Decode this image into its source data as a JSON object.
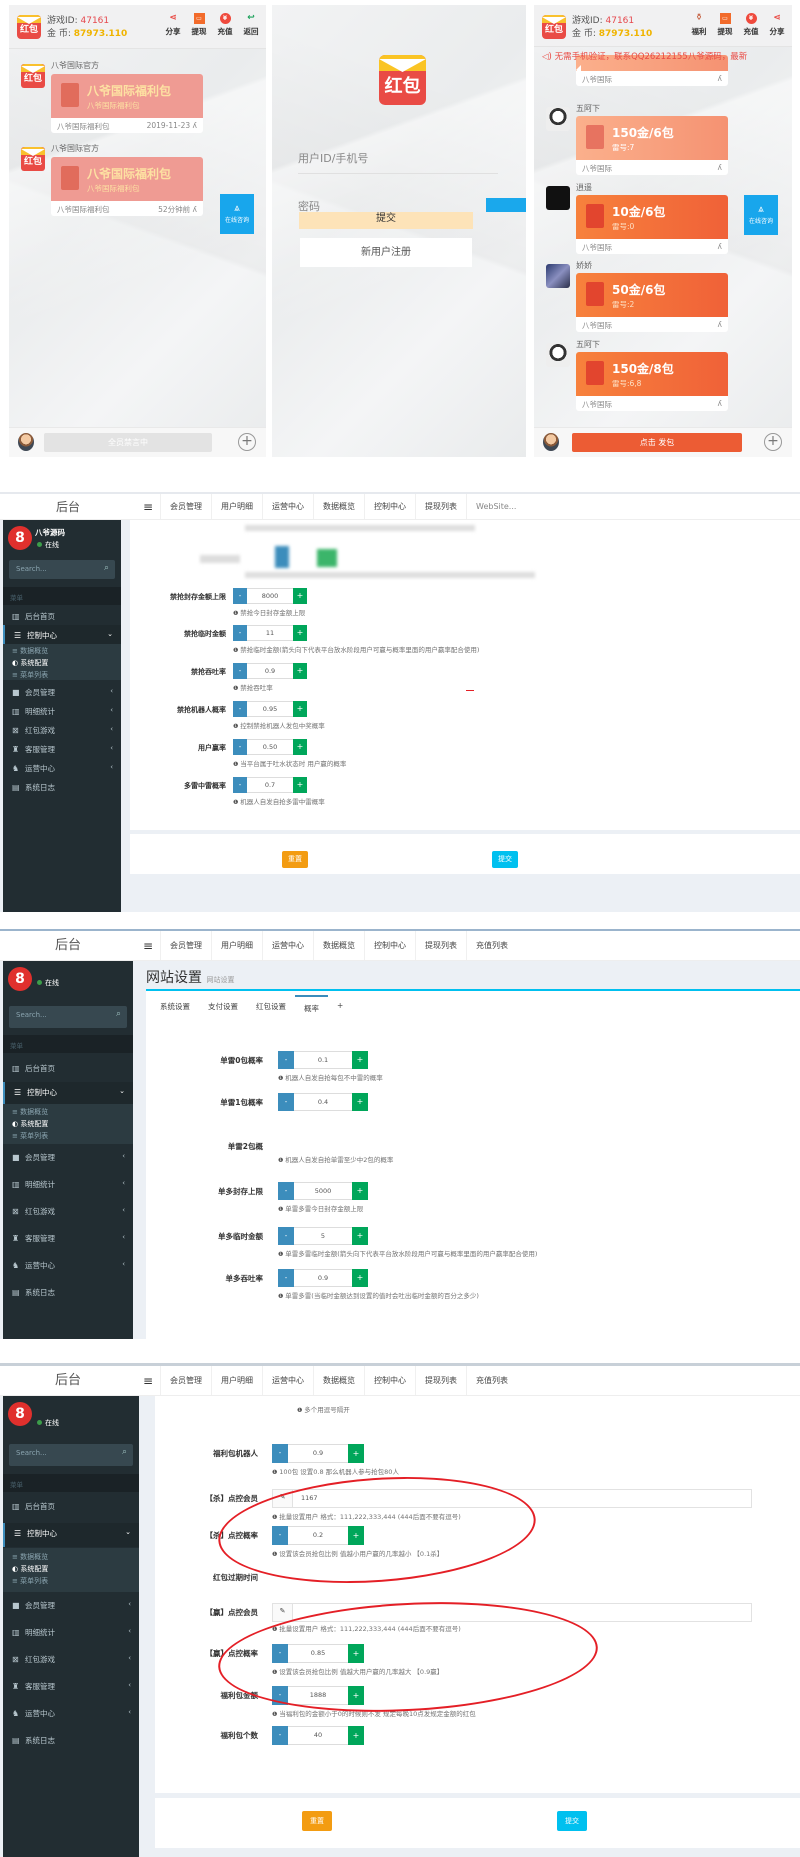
{
  "phone_left": {
    "game_id_label": "游戏ID:",
    "game_id": "47161",
    "coins_label": "金  币:",
    "coins": "87973.110",
    "logo_text": "红包",
    "top_icons": [
      {
        "icon": "share-icon",
        "label": "分享"
      },
      {
        "icon": "withdraw-icon",
        "label": "提现"
      },
      {
        "icon": "recharge-icon",
        "label": "充值"
      },
      {
        "icon": "back-icon",
        "label": "返回"
      }
    ],
    "messages": [
      {
        "sender": "八爷国际官方",
        "title": "八爷国际福利包",
        "subtitle": "八爷国际福利包",
        "footer": "八爷国际福利包",
        "time": "2019-11-23"
      },
      {
        "sender": "八爷国际官方",
        "title": "八爷国际福利包",
        "subtitle": "八爷国际福利包",
        "footer": "八爷国际福利包",
        "time": "52分钟前"
      }
    ],
    "online_consult": "在线咨询",
    "footer_button": "全员禁言中"
  },
  "phone_login": {
    "logo_text": "红包",
    "username_placeholder": "用户ID/手机号",
    "password_placeholder": "密码",
    "submit": "提交",
    "register": "新用户注册"
  },
  "phone_right": {
    "game_id_label": "游戏ID:",
    "game_id": "47161",
    "coins_label": "金  币:",
    "coins": "87973.110",
    "logo_text": "红包",
    "top_icons": [
      {
        "icon": "welfare-bag-icon",
        "label": "福利"
      },
      {
        "icon": "withdraw-icon",
        "label": "提现"
      },
      {
        "icon": "recharge-icon",
        "label": "充值"
      },
      {
        "icon": "share-icon",
        "label": "分享"
      }
    ],
    "marquee": "无需手机验证，联系QQ26212155八爷源码，最新",
    "partial_footer": "八爷国际",
    "messages": [
      {
        "sender": "五阿下",
        "title": "150金/6包",
        "subtitle": "雷号:7",
        "footer": "八爷国际"
      },
      {
        "sender": "逍遥",
        "title": "10金/6包",
        "subtitle": "雷号:0",
        "footer": "八爷国际"
      },
      {
        "sender": "娇娇",
        "title": "50金/6包",
        "subtitle": "雷号:2",
        "footer": "八爷国际"
      },
      {
        "sender": "五阿下",
        "title": "150金/8包",
        "subtitle": "雷号:6,8",
        "footer": "八爷国际"
      }
    ],
    "online_consult": "在线咨询",
    "footer_button": "点击 发包"
  },
  "admin_common": {
    "brand": "后台",
    "nav": [
      "会员管理",
      "用户明细",
      "运营中心",
      "数据概览",
      "控制中心",
      "提现列表",
      "充值列表"
    ],
    "search_placeholder": "Search...",
    "status": "在线",
    "menu_header": "菜单",
    "sidebar": [
      {
        "icon": "chart-icon",
        "label": "后台首页"
      },
      {
        "icon": "control-icon",
        "label": "控制中心",
        "expanded": true
      },
      {
        "icon": "member-icon",
        "label": "会员管理"
      },
      {
        "icon": "stats-icon",
        "label": "明细统计"
      },
      {
        "icon": "game-icon",
        "label": "红包游戏"
      },
      {
        "icon": "service-icon",
        "label": "客服管理"
      },
      {
        "icon": "ops-icon",
        "label": "运营中心"
      },
      {
        "icon": "log-icon",
        "label": "系统日志"
      }
    ],
    "submenu": [
      "数据概览",
      "系统配置",
      "菜单列表"
    ],
    "reset": "重置",
    "submit": "提交"
  },
  "admin1": {
    "username": "八爷源码",
    "nav_last": "WebSite...",
    "fields": [
      {
        "label": "禁抢封存金额上限",
        "value": "8000",
        "help": "禁抢今日封存金额上限"
      },
      {
        "label": "禁抢临时金额",
        "value": "11",
        "help": "禁抢临时金额(箭头向下代表平台放水阶段用户可赢与概率里面的用户赢率配合使用)"
      },
      {
        "label": "禁抢吞吐率",
        "value": "0.9",
        "help": "禁抢吞吐率"
      },
      {
        "label": "禁抢机器人概率",
        "value": "0.95",
        "help": "控制禁抢机器人发包中奖概率"
      },
      {
        "label": "用户赢率",
        "value": "0.50",
        "help": "当平台属于吐水状态时 用户赢的概率"
      },
      {
        "label": "多雷中雷概率",
        "value": "0.7",
        "help": "机器人自发自抢多雷中雷概率"
      }
    ]
  },
  "admin2": {
    "page_title": "网站设置",
    "page_subtitle": "网站设置",
    "tabs": [
      "系统设置",
      "支付设置",
      "红包设置",
      "概率",
      "+"
    ],
    "active_tab": 3,
    "fields": [
      {
        "label": "单雷0包概率",
        "value": "0.1",
        "help": "机器人自发自抢每包不中雷的概率"
      },
      {
        "label": "单雷1包概率",
        "value": "0.4",
        "help": ""
      },
      {
        "label": "单雷2包概",
        "value": "",
        "help": "机器人自发自抢单雷至少中2包的概率"
      },
      {
        "label": "单多封存上限",
        "value": "5000",
        "help": "单雷多雷今日封存金额上限"
      },
      {
        "label": "单多临时金额",
        "value": "5",
        "help": "单雷多雷临时金额(箭头向下代表平台放水阶段用户可赢与概率里面的用户赢率配合使用)"
      },
      {
        "label": "单多吞吐率",
        "value": "0.9",
        "help": "单雷多雷(当临时金额达到设置的值时会吐出临时金额的百分之多少)"
      }
    ]
  },
  "admin3": {
    "top_help": "多个用逗号隔开",
    "fields": [
      {
        "label": "福利包机器人",
        "value": "0.9",
        "help": "100包 设置0.8 那么机器人参与抢包80人",
        "type": "stepper"
      },
      {
        "label": "【杀】点控会员",
        "value": "1167",
        "help": "批量设置用户 格式：111,222,333,444 (444后面不要有逗号)",
        "type": "text"
      },
      {
        "label": "【杀】点控概率",
        "value": "0.2",
        "help": "设置该会员抢包比例 值越小用户赢的几率越小 【0.1杀】",
        "type": "stepper"
      },
      {
        "label": "红包过期时间",
        "value": "",
        "help": "",
        "type": "blank"
      },
      {
        "label": "【赢】点控会员",
        "value": "",
        "help": "批量设置用户 格式：111,222,333,444 (444后面不要有逗号)",
        "type": "text"
      },
      {
        "label": "【赢】点控概率",
        "value": "0.85",
        "help": "设置该会员抢包比例 值越大用户赢的几率越大 【0.9赢】",
        "type": "stepper"
      },
      {
        "label": "福利包金额",
        "value": "1888",
        "help": "当福利包的金额小于0的时候则不发 规定每晚10点发规定金额的红包",
        "type": "stepper"
      },
      {
        "label": "福利包个数",
        "value": "40",
        "help": "",
        "type": "stepper"
      }
    ]
  },
  "colors": {
    "sidebar_bg": "#222d32",
    "minus_btn": "#3c8dbc",
    "plus_btn": "#00a65a",
    "reset_btn": "#f39c12",
    "submit_btn": "#00c0ef",
    "annotation_red": "#e41f26",
    "redpacket_orange": "#f06138",
    "login_submit": "#fde3b8"
  }
}
